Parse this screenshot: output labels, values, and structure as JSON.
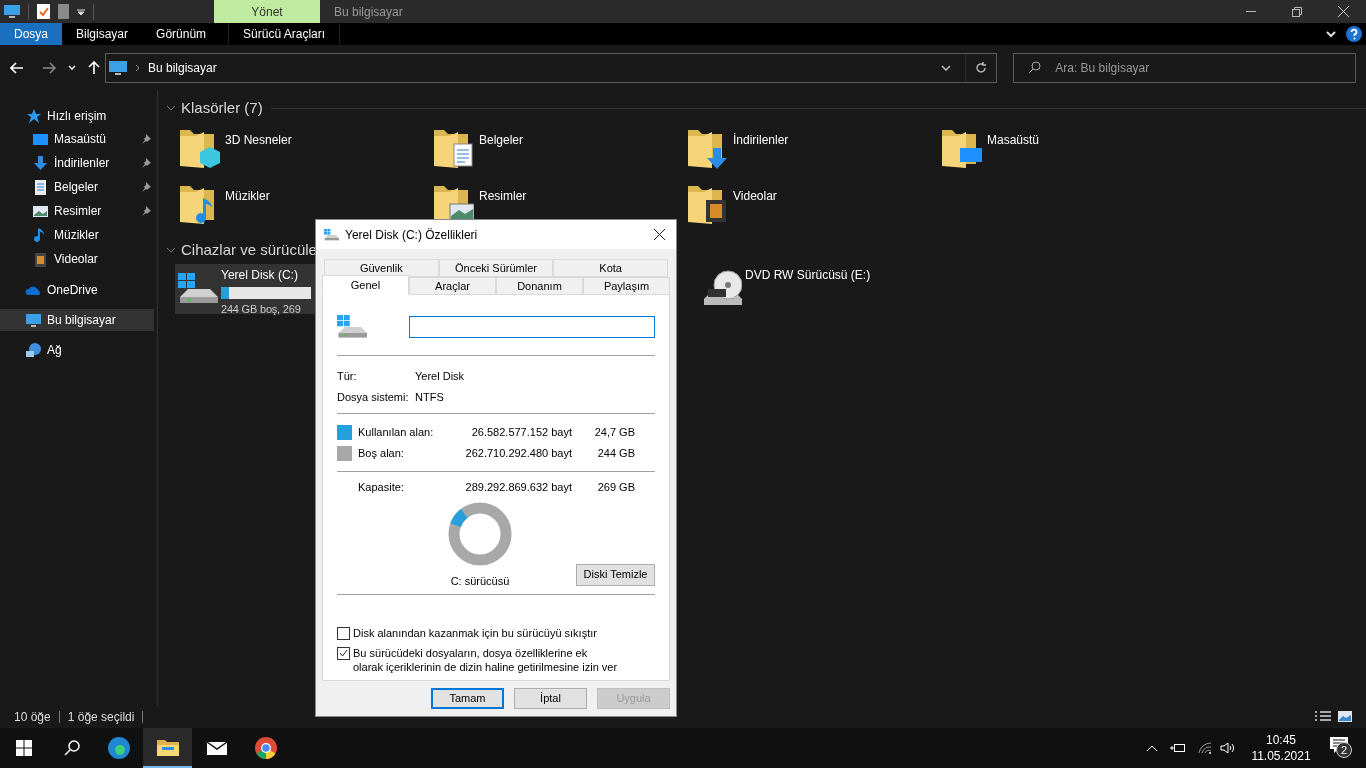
{
  "window": {
    "context_tab": "Yönet",
    "title": "Bu bilgisayar"
  },
  "ribbon_tabs": [
    {
      "label": "Dosya",
      "selected": true
    },
    {
      "label": "Bilgisayar",
      "selected": false
    },
    {
      "label": "Görünüm",
      "selected": false
    },
    {
      "label": "Sürücü Araçları",
      "selected": false
    }
  ],
  "address": {
    "path": "Bu bilgisayar",
    "search_placeholder": "Ara: Bu bilgisayar"
  },
  "sidebar": {
    "items": [
      {
        "kind": "quick",
        "label": "Hızlı erişim",
        "selected": false,
        "children": [
          {
            "kind": "desktop",
            "label": "Masaüstü",
            "pinned": true
          },
          {
            "kind": "download",
            "label": "İndirilenler",
            "pinned": true
          },
          {
            "kind": "document",
            "label": "Belgeler",
            "pinned": true
          },
          {
            "kind": "picture",
            "label": "Resimler",
            "pinned": true
          },
          {
            "kind": "music",
            "label": "Müzikler",
            "pinned": false
          },
          {
            "kind": "video",
            "label": "Videolar",
            "pinned": false
          }
        ]
      },
      {
        "kind": "cloud",
        "label": "OneDrive",
        "selected": false
      },
      {
        "kind": "pc",
        "label": "Bu bilgisayar",
        "selected": true
      },
      {
        "kind": "network",
        "label": "Ağ",
        "selected": false
      }
    ]
  },
  "folders": {
    "title": "Klasörler (7)",
    "items": [
      {
        "kind": "cube",
        "label": "3D Nesneler"
      },
      {
        "kind": "document",
        "label": "Belgeler"
      },
      {
        "kind": "download",
        "label": "İndirilenler"
      },
      {
        "kind": "desktop",
        "label": "Masaüstü"
      },
      {
        "kind": "music",
        "label": "Müzikler"
      },
      {
        "kind": "picture",
        "label": "Resimler"
      },
      {
        "kind": "video",
        "label": "Videolar"
      }
    ]
  },
  "devices": {
    "title": "Cihazlar ve sürücüle",
    "items": [
      {
        "kind": "disk",
        "label": "Yerel Disk (C:)",
        "level": 0.09,
        "detail": "244 GB boş, 269",
        "selected": true
      },
      {
        "kind": "dvd",
        "label": "DVD RW Sürücüsü (E:)",
        "selected": false
      }
    ]
  },
  "dialog": {
    "title": "Yerel Disk (C:) Özellikleri",
    "tab_rows": [
      [
        {
          "label": "Güvenlik",
          "selected": false
        },
        {
          "label": "Önceki Sürümler",
          "selected": false
        },
        {
          "label": "Kota",
          "selected": false
        }
      ],
      [
        {
          "label": "Genel",
          "selected": true
        },
        {
          "label": "Araçlar",
          "selected": false
        },
        {
          "label": "Donanım",
          "selected": false
        },
        {
          "label": "Paylaşım",
          "selected": false
        }
      ]
    ],
    "type_label": "Tür:",
    "type_value": "Yerel Disk",
    "fs_label": "Dosya sistemi:",
    "fs_value": "NTFS",
    "space": [
      {
        "label": "Kullanılan alan:",
        "bytes": "26.582.577.152 bayt",
        "size": "24,7 GB",
        "color": "#26a0da"
      },
      {
        "label": "Boş alan:",
        "bytes": "262.710.292.480 bayt",
        "size": "244 GB",
        "color": "#a8a8a8"
      }
    ],
    "capacity": {
      "label": "Kapasite:",
      "bytes": "289.292.869.632 bayt",
      "size": "269 GB"
    },
    "used_share": {
      "level": 0.09
    },
    "drive_caption": "C: sürücüsü",
    "cleanup_button": "Diski Temizle",
    "options": [
      {
        "label": "Disk alanından kazanmak için bu sürücüyü sıkıştır",
        "checked": false
      },
      {
        "label": "Bu sürücüdeki dosyaların, dosya özelliklerine ek olarak içeriklerinin de dizin haline getirilmesine izin ver",
        "checked": true
      }
    ],
    "buttons": [
      {
        "label": "Tamam",
        "kind": "default",
        "disabled": false
      },
      {
        "label": "İptal",
        "kind": "normal",
        "disabled": false
      },
      {
        "label": "Uygula",
        "kind": "normal",
        "disabled": true
      }
    ]
  },
  "status_bar": {
    "count": "10 öğe",
    "selection": "1 öğe seçildi"
  },
  "taskbar": {
    "apps": [
      {
        "kind": "edge",
        "selected": false
      },
      {
        "kind": "explorer",
        "selected": true
      },
      {
        "kind": "mail",
        "selected": false
      },
      {
        "kind": "chrome",
        "selected": false
      }
    ],
    "time": "10:45",
    "date": "11.05.2021",
    "notifications": "2"
  }
}
